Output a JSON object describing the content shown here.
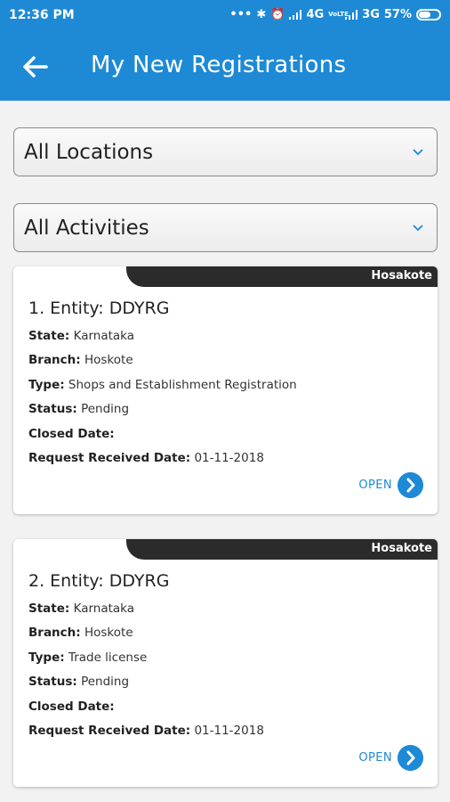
{
  "status_bar": {
    "time": "12:36 PM",
    "network_1": "4G",
    "network_2": "3G",
    "battery": "57%",
    "vo_lte": "VoLTE",
    "battery_level": 0.57
  },
  "header": {
    "title": "My New Registrations",
    "background": "#1e8ad6"
  },
  "filters": {
    "location": "All Locations",
    "activity": "All Activities"
  },
  "cards": [
    {
      "tag": "Hosakote",
      "entity": "1. Entity: DDYRG",
      "state_label": "State:",
      "state": " Karnataka",
      "branch_label": "Branch:",
      "branch": " Hoskote",
      "type_label": "Type:",
      "type": " Shops and Establishment Registration",
      "status_label": "Status:",
      "status": " Pending",
      "closed_label": "Closed Date:",
      "closed": "",
      "received_label": "Request Received Date:",
      "received": " 01-11-2018",
      "action": "OPEN"
    },
    {
      "tag": "Hosakote",
      "entity": "2. Entity: DDYRG",
      "state_label": "State:",
      "state": " Karnataka",
      "branch_label": "Branch:",
      "branch": " Hoskote",
      "type_label": "Type:",
      "type": " Trade license",
      "status_label": "Status:",
      "status": " Pending",
      "closed_label": "Closed Date:",
      "closed": "",
      "received_label": "Request Received Date:",
      "received": " 01-11-2018",
      "action": "OPEN"
    }
  ]
}
